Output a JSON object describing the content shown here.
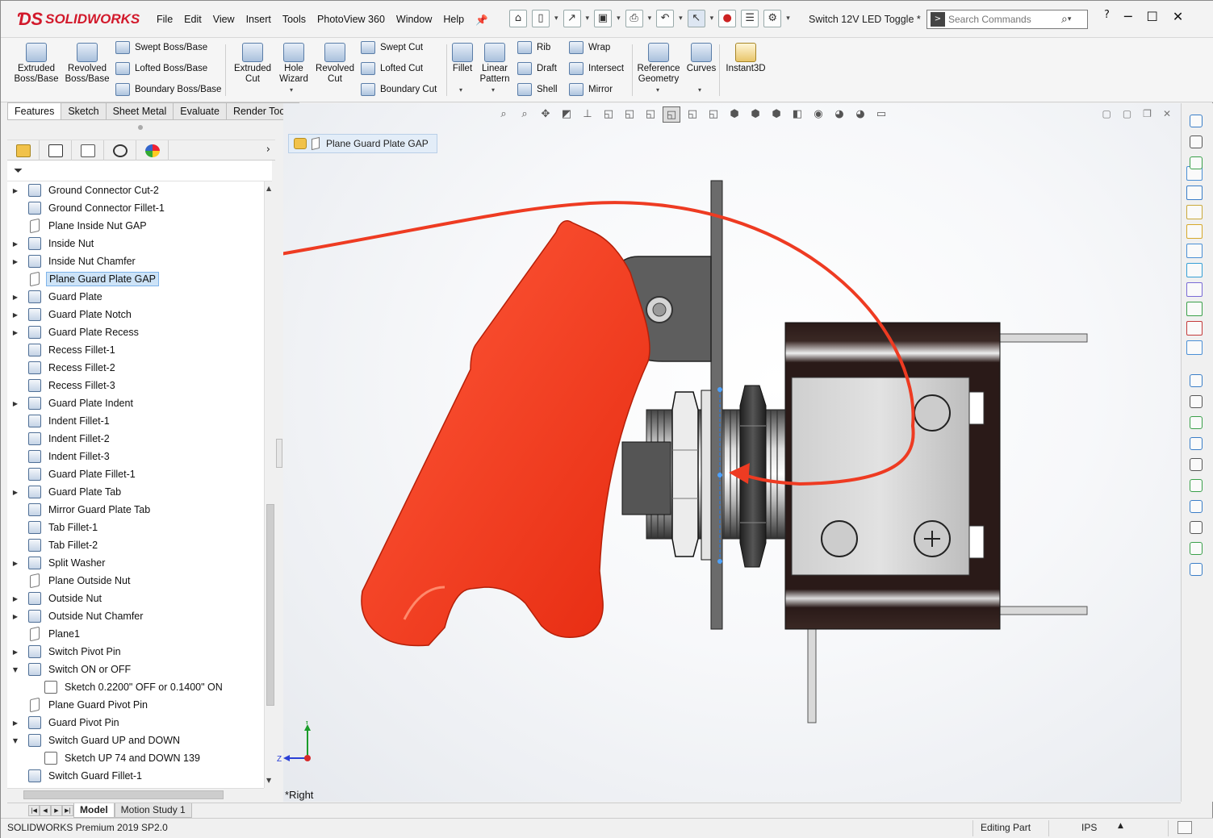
{
  "app": {
    "brand": "SOLIDWORKS",
    "document_title": "Switch 12V LED Toggle *",
    "menus": [
      "File",
      "Edit",
      "View",
      "Insert",
      "Tools",
      "PhotoView 360",
      "Window",
      "Help"
    ],
    "search_placeholder": "Search Commands"
  },
  "ribbon": {
    "extruded_boss": "Extruded\nBoss/Base",
    "revolved_boss": "Revolved\nBoss/Base",
    "swept_boss": "Swept Boss/Base",
    "lofted_boss": "Lofted Boss/Base",
    "boundary_boss": "Boundary Boss/Base",
    "extruded_cut": "Extruded\nCut",
    "hole_wizard": "Hole\nWizard",
    "revolved_cut": "Revolved\nCut",
    "swept_cut": "Swept Cut",
    "lofted_cut": "Lofted Cut",
    "boundary_cut": "Boundary Cut",
    "fillet": "Fillet",
    "linear_pattern": "Linear\nPattern",
    "rib": "Rib",
    "draft": "Draft",
    "shell": "Shell",
    "wrap": "Wrap",
    "intersect": "Intersect",
    "mirror": "Mirror",
    "reference_geometry": "Reference\nGeometry",
    "curves": "Curves",
    "instant3d": "Instant3D"
  },
  "tabs": [
    "Features",
    "Sketch",
    "Sheet Metal",
    "Evaluate",
    "Render Tools"
  ],
  "feature_tree": [
    {
      "label": "Ground Connector Cut-2",
      "type": "feature",
      "expand": true,
      "indent": 0
    },
    {
      "label": "Ground Connector Fillet-1",
      "type": "feature",
      "expand": false,
      "indent": 0
    },
    {
      "label": "Plane Inside Nut GAP",
      "type": "plane",
      "expand": false,
      "indent": 0
    },
    {
      "label": "Inside Nut",
      "type": "feature",
      "expand": true,
      "indent": 0
    },
    {
      "label": "Inside Nut Chamfer",
      "type": "feature",
      "expand": true,
      "indent": 0
    },
    {
      "label": "Plane Guard Plate GAP",
      "type": "plane",
      "expand": false,
      "indent": 0,
      "selected": true
    },
    {
      "label": "Guard Plate",
      "type": "feature",
      "expand": true,
      "indent": 0
    },
    {
      "label": "Guard Plate Notch",
      "type": "feature",
      "expand": true,
      "indent": 0
    },
    {
      "label": "Guard Plate Recess",
      "type": "feature",
      "expand": true,
      "indent": 0
    },
    {
      "label": "Recess Fillet-1",
      "type": "feature",
      "expand": false,
      "indent": 0
    },
    {
      "label": "Recess Fillet-2",
      "type": "feature",
      "expand": false,
      "indent": 0
    },
    {
      "label": "Recess Fillet-3",
      "type": "feature",
      "expand": false,
      "indent": 0
    },
    {
      "label": "Guard Plate Indent",
      "type": "feature",
      "expand": true,
      "indent": 0
    },
    {
      "label": "Indent Fillet-1",
      "type": "feature",
      "expand": false,
      "indent": 0
    },
    {
      "label": "Indent Fillet-2",
      "type": "feature",
      "expand": false,
      "indent": 0
    },
    {
      "label": "Indent Fillet-3",
      "type": "feature",
      "expand": false,
      "indent": 0
    },
    {
      "label": "Guard Plate Fillet-1",
      "type": "feature",
      "expand": false,
      "indent": 0
    },
    {
      "label": "Guard Plate Tab",
      "type": "feature",
      "expand": true,
      "indent": 0
    },
    {
      "label": "Mirror Guard Plate Tab",
      "type": "feature",
      "expand": false,
      "indent": 0
    },
    {
      "label": "Tab Fillet-1",
      "type": "feature",
      "expand": false,
      "indent": 0
    },
    {
      "label": "Tab Fillet-2",
      "type": "feature",
      "expand": false,
      "indent": 0
    },
    {
      "label": "Split Washer",
      "type": "feature",
      "expand": true,
      "indent": 0
    },
    {
      "label": "Plane Outside Nut",
      "type": "plane",
      "expand": false,
      "indent": 0
    },
    {
      "label": "Outside Nut",
      "type": "feature",
      "expand": true,
      "indent": 0
    },
    {
      "label": "Outside Nut Chamfer",
      "type": "feature",
      "expand": true,
      "indent": 0
    },
    {
      "label": "Plane1",
      "type": "plane",
      "expand": false,
      "indent": 0
    },
    {
      "label": "Switch Pivot Pin",
      "type": "feature",
      "expand": true,
      "indent": 0
    },
    {
      "label": "Switch ON or OFF",
      "type": "feature",
      "expand": "open",
      "indent": 0
    },
    {
      "label": "Sketch 0.2200\" OFF or  0.1400\" ON",
      "type": "sketch",
      "expand": false,
      "indent": 1
    },
    {
      "label": "Plane Guard Pivot Pin",
      "type": "plane",
      "expand": false,
      "indent": 0
    },
    {
      "label": "Guard Pivot Pin",
      "type": "feature",
      "expand": true,
      "indent": 0
    },
    {
      "label": "Switch Guard UP and DOWN",
      "type": "feature",
      "expand": "open",
      "indent": 0
    },
    {
      "label": "Sketch UP 74 and DOWN 139",
      "type": "sketch",
      "expand": false,
      "indent": 1
    },
    {
      "label": "Switch Guard Fillet-1",
      "type": "feature",
      "expand": false,
      "indent": 0
    }
  ],
  "viewport": {
    "breadcrumb": "Plane Guard Plate GAP",
    "view_name": "*Right",
    "triad_z": "Z",
    "triad_y": "Y"
  },
  "colors": {
    "guard": "#f5391c",
    "annotation_arrow": "#ee3b22",
    "selection": "#cde3f7",
    "brand": "#d2192b"
  },
  "bottom_tabs": [
    "Model",
    "Motion Study 1"
  ],
  "status": {
    "product": "SOLIDWORKS Premium 2019 SP2.0",
    "mode": "Editing Part",
    "units": "IPS"
  }
}
